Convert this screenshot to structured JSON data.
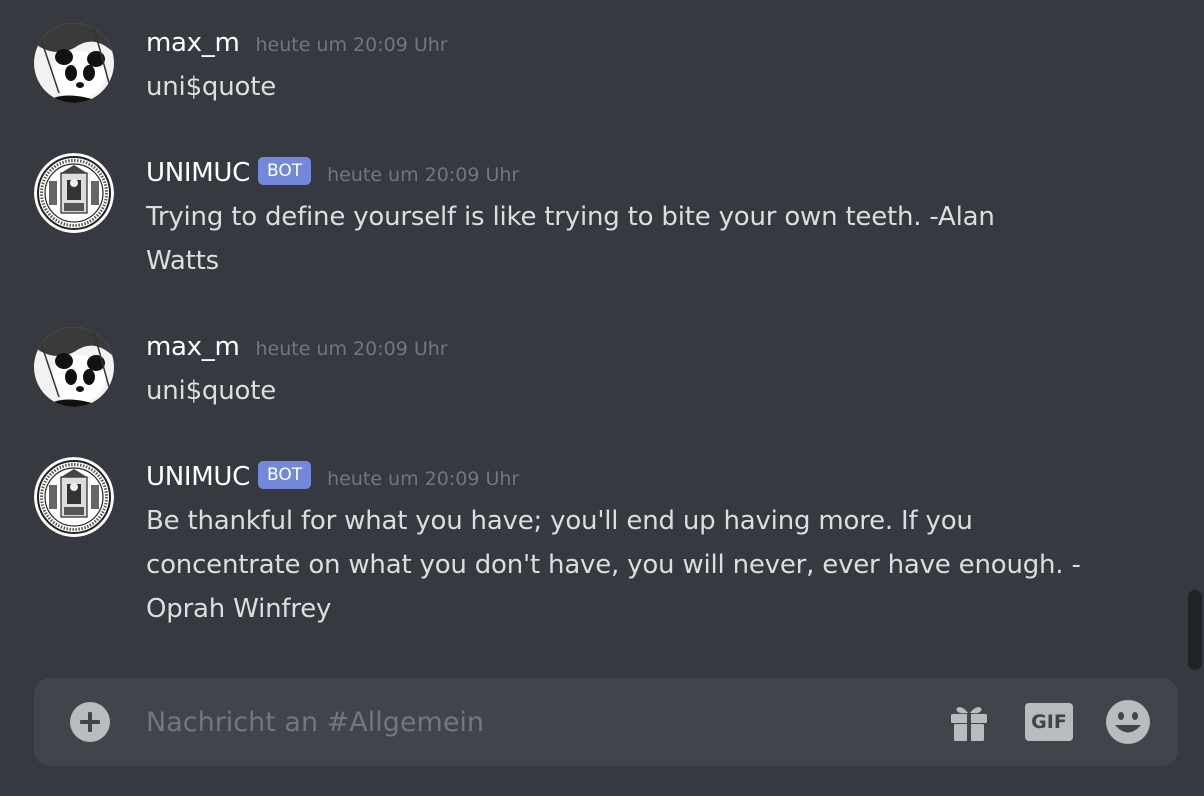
{
  "channel": {
    "input_placeholder": "Nachricht an #Allgemein"
  },
  "messages": [
    {
      "author": "max_m",
      "bot": false,
      "timestamp": "heute um 20:09 Uhr",
      "content": "uni$quote",
      "avatar_icon": "panda-avatar-icon"
    },
    {
      "author": "UNIMUC",
      "bot": true,
      "bot_label": "BOT",
      "timestamp": "heute um 20:09 Uhr",
      "content": "Trying to define yourself is like trying to bite your own teeth. -Alan Watts",
      "avatar_icon": "university-seal-icon"
    },
    {
      "author": "max_m",
      "bot": false,
      "timestamp": "heute um 20:09 Uhr",
      "content": "uni$quote",
      "avatar_icon": "panda-avatar-icon"
    },
    {
      "author": "UNIMUC",
      "bot": true,
      "bot_label": "BOT",
      "timestamp": "heute um 20:09 Uhr",
      "content": "Be thankful for what you have; you'll end up having more. If you concentrate on what you don't have, you will never, ever have enough.  -Oprah Winfrey",
      "avatar_icon": "university-seal-icon"
    }
  ],
  "composer": {
    "gif_label": "GIF",
    "icons": [
      "plus-circle-icon",
      "gift-icon",
      "gif-icon",
      "smiley-icon"
    ]
  },
  "colors": {
    "background": "#36393f",
    "composer": "#40444b",
    "bot_tag": "#7289da",
    "username": "#ffffff",
    "text": "#dcddde",
    "muted": "#72767d",
    "icon": "#b9bbbe"
  }
}
